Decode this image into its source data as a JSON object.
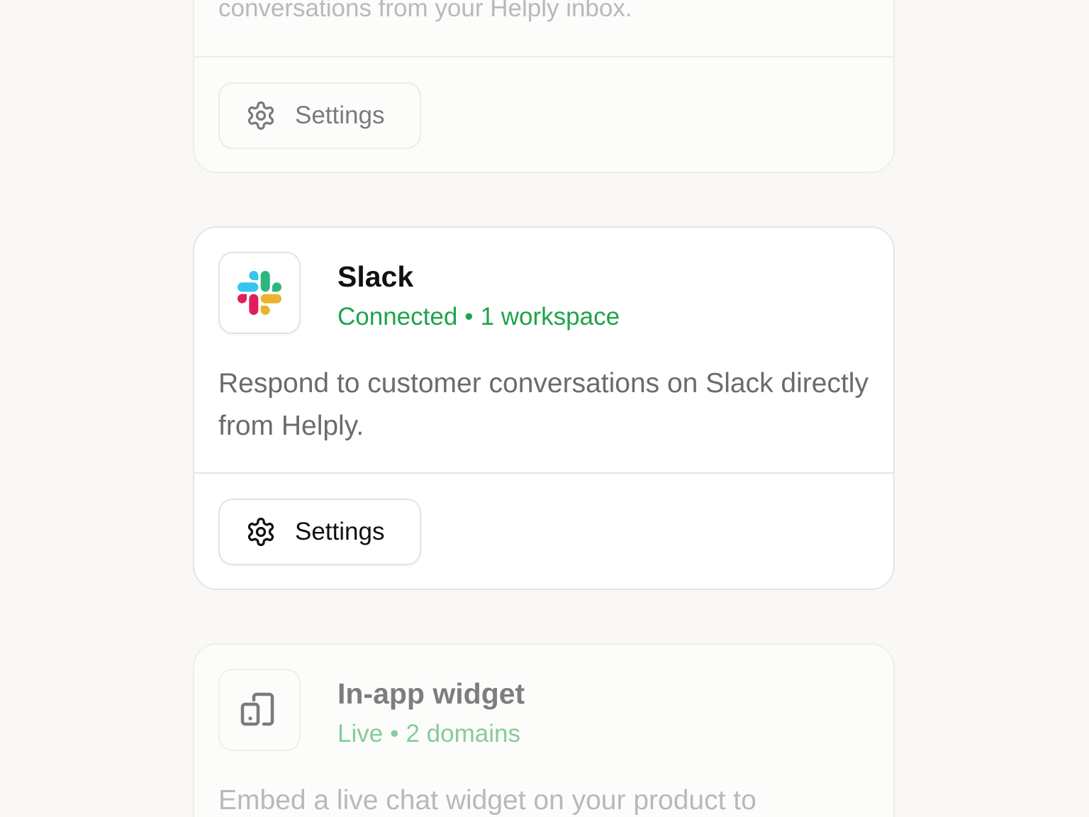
{
  "cards": [
    {
      "description_tail": "conversations from your Helply inbox.",
      "settings_label": "Settings"
    },
    {
      "title": "Slack",
      "status": "Connected",
      "status_detail": "1 workspace",
      "separator": "•",
      "description": "Respond to customer conversations on Slack directly from Helply.",
      "settings_label": "Settings",
      "logo_icon": "slack-logo",
      "logo_colors": [
        "#36C5F0",
        "#2EB67D",
        "#E01E5A",
        "#ECB22E"
      ]
    },
    {
      "title": "In-app widget",
      "status": "Live",
      "status_detail": "2 domains",
      "separator": "•",
      "description": "Embed a live chat widget on your product to",
      "logo_icon": "device-icon"
    }
  ],
  "colors": {
    "status_green": "#1fa34a",
    "background": "#f9f8f6"
  }
}
